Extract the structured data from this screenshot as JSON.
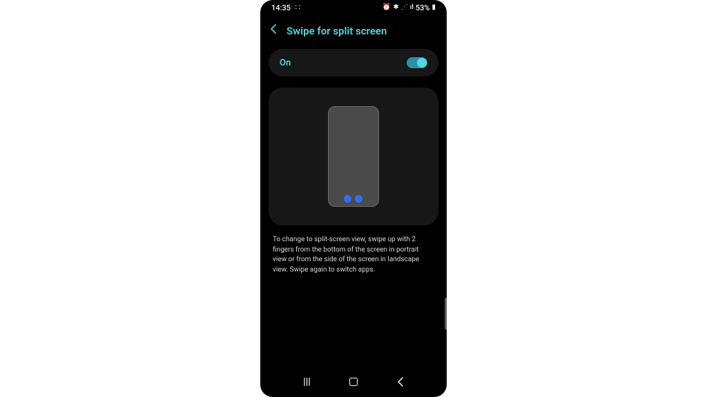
{
  "statusBar": {
    "time": "14:35",
    "batteryText": "53%"
  },
  "header": {
    "title": "Swipe for split screen"
  },
  "toggleCard": {
    "label": "On",
    "state": true
  },
  "description": "To change to split-screen view, swipe up with 2 fingers from the bottom of the screen in portrait view or from the side of the screen in landscape view. Swipe again to switch apps.",
  "colors": {
    "accent": "#4fd8e0",
    "cardBg": "#171717",
    "fingerDot": "#2f6fff"
  }
}
